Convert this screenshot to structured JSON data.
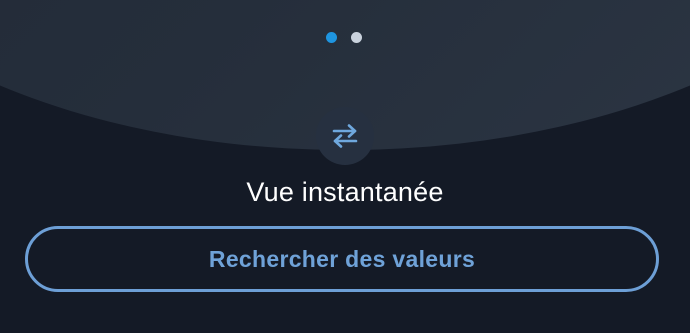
{
  "pager": {
    "total": 2,
    "active_index": 0
  },
  "feature": {
    "icon": "swap-arrows-icon",
    "title": "Vue instantanée"
  },
  "actions": {
    "search_label": "Rechercher des valeurs"
  },
  "colors": {
    "background": "#141a26",
    "dome": "#252e3b",
    "accent": "#1e95e0",
    "button_outline": "#6d9fd6",
    "dot_inactive": "#c9d2dd"
  }
}
